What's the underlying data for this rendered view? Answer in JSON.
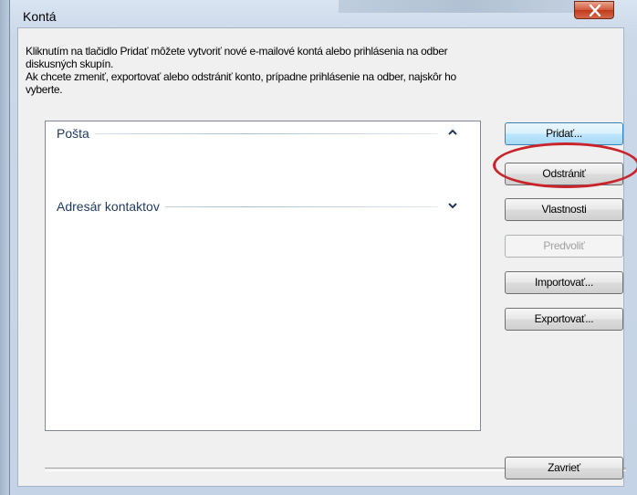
{
  "window": {
    "title": "Kontá"
  },
  "description": {
    "line1": "Kliknutím na tlačidlo Pridať môžete vytvoriť nové e-mailové kontá alebo prihlásenia na odber",
    "line2": "diskusných skupín.",
    "line3": "Ak chcete zmeniť, exportovať alebo odstrániť konto, prípadne prihlásenie na odber, najskôr ho",
    "line4": "vyberte."
  },
  "groups": [
    {
      "label": "Pošta",
      "state": "expanded"
    },
    {
      "label": "Adresár kontaktov",
      "state": "collapsed"
    }
  ],
  "buttons": {
    "add": "Pridať...",
    "remove": "Odstrániť",
    "properties": "Vlastnosti",
    "set_default": "Predvoliť",
    "import": "Importovať...",
    "export": "Exportovať...",
    "close": "Zavrieť"
  },
  "colors": {
    "highlight_ring": "#c8242c",
    "close_button": "#c8462a",
    "group_header_text": "#1e395b"
  }
}
